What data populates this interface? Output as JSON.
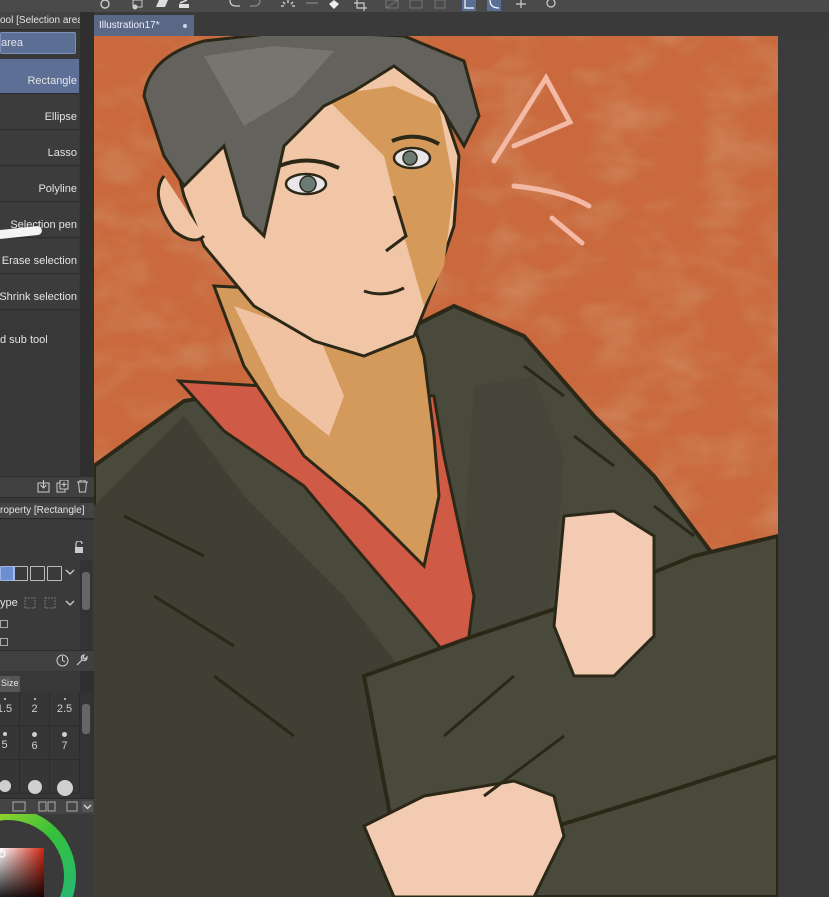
{
  "app": {
    "document_tab": "Illustration17*"
  },
  "subtool_panel": {
    "header": "ool [Selection area]",
    "group_tab": "area",
    "items": [
      {
        "label": "Rectangle",
        "selected": true
      },
      {
        "label": "Ellipse",
        "selected": false
      },
      {
        "label": "Lasso",
        "selected": false
      },
      {
        "label": "Polyline",
        "selected": false
      },
      {
        "label": "Selection pen",
        "selected": false
      },
      {
        "label": "Erase selection",
        "selected": false
      },
      {
        "label": "Shrink selection",
        "selected": false
      }
    ],
    "add_subtool": "d sub tool"
  },
  "tool_property": {
    "header": "roperty [Rectangle]",
    "type_label": "ype"
  },
  "brush_size": {
    "tab": "Size",
    "cells": [
      {
        "label": "1.5"
      },
      {
        "label": "2"
      },
      {
        "label": "2.5"
      },
      {
        "label": "5"
      },
      {
        "label": "6"
      },
      {
        "label": "7"
      }
    ]
  },
  "colors": {
    "accent": "#5d6f95",
    "panel": "#383838",
    "canvas_bg": "#c5643a"
  },
  "icons": {
    "toolbar": [
      "app-icon",
      "new-layer-icon",
      "folder-icon",
      "save-icon",
      "undo-icon",
      "redo-icon",
      "loading-icon",
      "transform-icon",
      "fill-icon",
      "crop-icon",
      "grid-icon",
      "ruler-icon",
      "snap-icon",
      "lasso-mode-icon",
      "lasso-mode2-icon",
      "canvas-settings-icon",
      "help-icon"
    ],
    "subtool_footer": [
      "export-icon",
      "duplicate-icon",
      "trash-icon"
    ]
  }
}
